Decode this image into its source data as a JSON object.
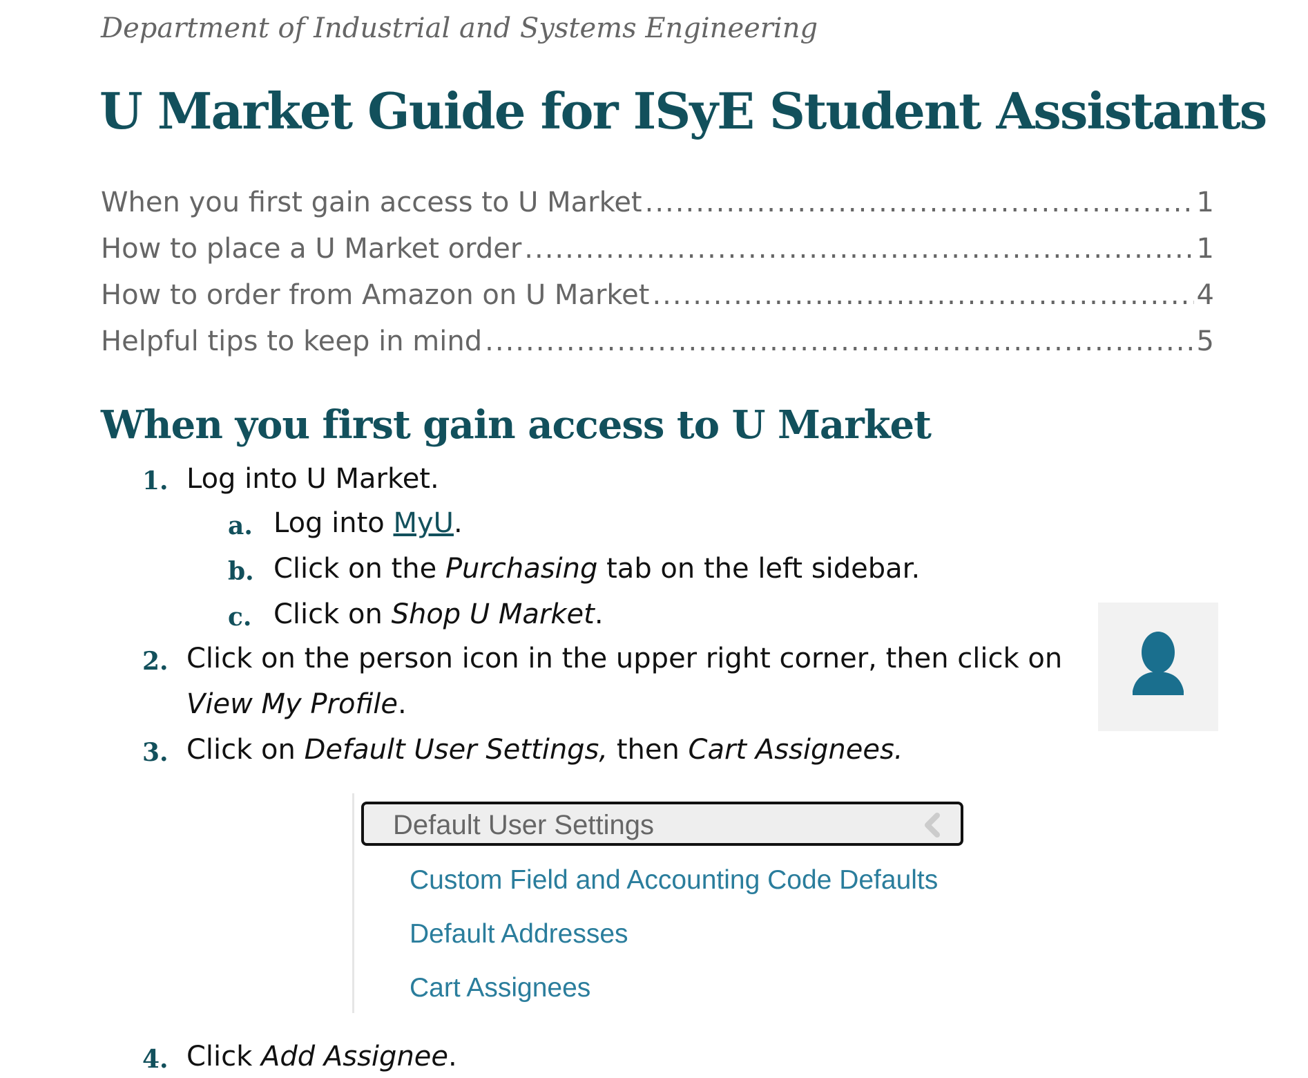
{
  "header": {
    "department": "Department of Industrial and Systems Engineering",
    "title": "U Market Guide for ISyE Student Assistants"
  },
  "toc": [
    {
      "text": "When you first gain access to U Market",
      "page": "1"
    },
    {
      "text": "How to place a U Market order",
      "page": "1"
    },
    {
      "text": "How to order from Amazon on U Market",
      "page": "4"
    },
    {
      "text": "Helpful tips to keep in mind",
      "page": "5"
    }
  ],
  "section": {
    "heading": "When you first gain access to U Market",
    "steps": [
      {
        "marker": "1.",
        "text": "Log into U Market."
      },
      {
        "marker": "a.",
        "pre": "Log into ",
        "link": "MyU",
        "post": "."
      },
      {
        "marker": "b.",
        "pre": "Click on the ",
        "em": "Purchasing",
        "post": " tab on the left sidebar."
      },
      {
        "marker": "c.",
        "pre": "Click on ",
        "em": "Shop U Market",
        "post": "."
      },
      {
        "marker": "2.",
        "text": "Click on the person icon in the upper right corner, then click on",
        "em2": "View My Profile",
        "post2": "."
      },
      {
        "marker": "3.",
        "pre": "Click on ",
        "em": "Default User Settings,",
        "mid": " then ",
        "em_b": "Cart Assignees."
      },
      {
        "marker": "4.",
        "pre": "Click ",
        "em": "Add Assignee",
        "post": "."
      }
    ]
  },
  "menu_screenshot": {
    "header": "Default User Settings",
    "items": [
      "Custom Field and Accounting Code Defaults",
      "Default Addresses",
      "Cart Assignees"
    ]
  },
  "icons": {
    "avatar": "person-icon",
    "chevron": "chevron-left-icon"
  },
  "colors": {
    "heading": "#12505c",
    "link": "#2a7d9c",
    "avatar": "#1a6f8e"
  }
}
